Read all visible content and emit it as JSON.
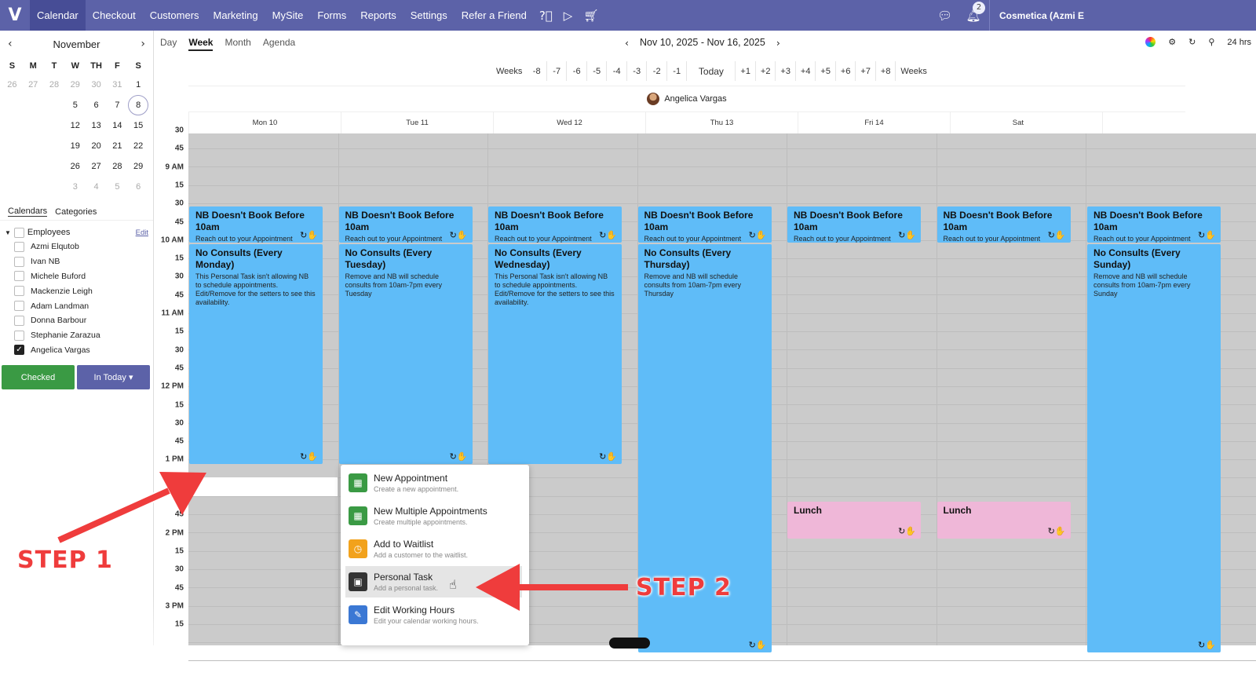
{
  "nav": {
    "items": [
      "Calendar",
      "Checkout",
      "Customers",
      "Marketing",
      "MySite",
      "Forms",
      "Reports",
      "Settings",
      "Refer a Friend"
    ],
    "notifications": "2",
    "business": "Cosmetica (Azmi E"
  },
  "minical": {
    "month": "November",
    "dows": [
      "S",
      "M",
      "T",
      "W",
      "TH",
      "F",
      "S"
    ],
    "days": [
      "26",
      "27",
      "28",
      "29",
      "30",
      "31",
      "1",
      "",
      "",
      "",
      "5",
      "6",
      "7",
      "8",
      "",
      "",
      "",
      "12",
      "13",
      "14",
      "15",
      "",
      "",
      "",
      "19",
      "20",
      "21",
      "22",
      "",
      "",
      "",
      "26",
      "27",
      "28",
      "29",
      "",
      "",
      "",
      "3",
      "4",
      "5",
      "6"
    ],
    "today": "8"
  },
  "sidebar": {
    "tab_calendars": "Calendars",
    "tab_categories": "Categories",
    "group": "Employees",
    "edit": "Edit",
    "employees": [
      "Azmi Elqutob",
      "Ivan NB",
      "Michele Buford",
      "Mackenzie Leigh",
      "Adam Landman",
      "Donna Barbour",
      "Stephanie Zarazua",
      "Angelica Vargas"
    ],
    "checked_btn": "Checked",
    "in_today_btn": "In Today ▾"
  },
  "toolbar": {
    "views": [
      "Day",
      "Week",
      "Month",
      "Agenda"
    ],
    "range": "Nov 10, 2025 - Nov 16, 2025",
    "hrs": "24 hrs",
    "weeks_label": "Weeks",
    "week_offsets": [
      "-8",
      "-7",
      "-6",
      "-5",
      "-4",
      "-3",
      "-2",
      "-1",
      "Today",
      "+1",
      "+2",
      "+3",
      "+4",
      "+5",
      "+6",
      "+7",
      "+8"
    ]
  },
  "calendar": {
    "person": "Angelica Vargas",
    "days": [
      "Mon 10",
      "Tue 11",
      "Wed 12",
      "Thu 13",
      "Fri 14",
      "Sat",
      ""
    ],
    "times": [
      "30",
      "45",
      "9 AM",
      "15",
      "30",
      "45",
      "10 AM",
      "15",
      "30",
      "45",
      "11 AM",
      "15",
      "30",
      "45",
      "12 PM",
      "15",
      "30",
      "45",
      "1 PM",
      "",
      "",
      "45",
      "2 PM",
      "15",
      "30",
      "45",
      "3 PM",
      "15"
    ]
  },
  "events": {
    "nb_title": "NB Doesn't Book Before 10am",
    "nb_desc": "Reach out to your Appointment",
    "mon_title": "No Consults (Every Monday)",
    "mon_desc": "This Personal Task isn't allowing NB to schedule appointments. Edit/Remove for the setters to see this availability.",
    "tue_title": "No Consults (Every Tuesday)",
    "tue_desc": "Remove and NB will schedule consults from 10am-7pm every Tuesday",
    "wed_title": "No Consults (Every Wednesday)",
    "wed_desc": "This Personal Task isn't allowing NB to schedule appointments. Edit/Remove for the setters to see this availability.",
    "thu_title": "No Consults (Every Thursday)",
    "thu_desc": "Remove and NB will schedule consults from 10am-7pm every Thursday",
    "sun_title": "No Consults (Every Sunday)",
    "sun_desc": "Remove and NB will schedule consults from 10am-7pm every Sunday",
    "lunch": "Lunch"
  },
  "popup": [
    {
      "title": "New Appointment",
      "desc": "Create a new appointment.",
      "color": "#3a9a44",
      "icon": "calendar-icon"
    },
    {
      "title": "New Multiple Appointments",
      "desc": "Create multiple appointments.",
      "color": "#3a9a44",
      "icon": "calendar-icon"
    },
    {
      "title": "Add to Waitlist",
      "desc": "Add a customer to the waitlist.",
      "color": "#f2a21c",
      "icon": "clock-icon"
    },
    {
      "title": "Personal Task",
      "desc": "Add a personal task.",
      "color": "#333333",
      "icon": "task-icon"
    },
    {
      "title": "Edit Working Hours",
      "desc": "Edit your calendar working hours.",
      "color": "#3b78d4",
      "icon": "pencil-icon"
    }
  ],
  "steps": {
    "step1": "STEP 1",
    "step2": "STEP 2"
  }
}
